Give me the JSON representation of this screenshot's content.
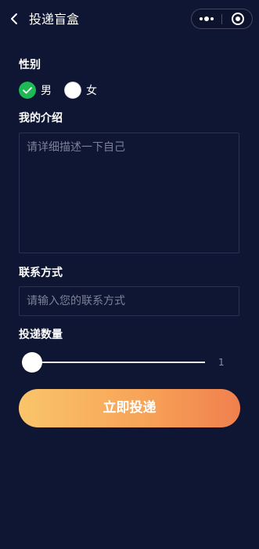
{
  "header": {
    "title": "投递盲盒"
  },
  "gender": {
    "label": "性别",
    "options": [
      {
        "label": "男",
        "selected": true
      },
      {
        "label": "女",
        "selected": false
      }
    ]
  },
  "intro": {
    "label": "我的介绍",
    "placeholder": "请详细描述一下自己"
  },
  "contact": {
    "label": "联系方式",
    "placeholder": "请输入您的联系方式"
  },
  "quantity": {
    "label": "投递数量",
    "value": "1",
    "level": 0
  },
  "submit": {
    "label": "立即投递"
  },
  "colors": {
    "background": "#0f1633",
    "selected_radio": "#1db954",
    "button_gradient_start": "#f9c56a",
    "button_gradient_end": "#f0804e"
  }
}
